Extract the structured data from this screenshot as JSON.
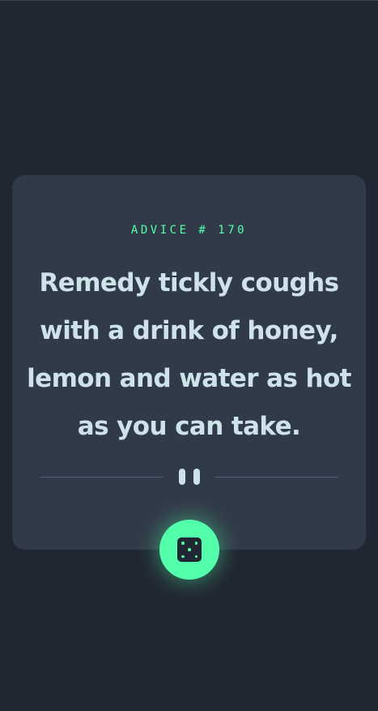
{
  "advice": {
    "id_label": "ADVICE # 170",
    "text": "Remedy tickly coughs with a drink of honey, lemon and water as hot as you can take."
  },
  "divider": {
    "icon": "pause-icon"
  },
  "generate_button": {
    "icon": "dice-icon"
  },
  "colors": {
    "background": "#202632",
    "card": "#313a48",
    "accent": "#53ffaa",
    "quote_text": "#cee3e9",
    "divider": "#4f5d74"
  }
}
